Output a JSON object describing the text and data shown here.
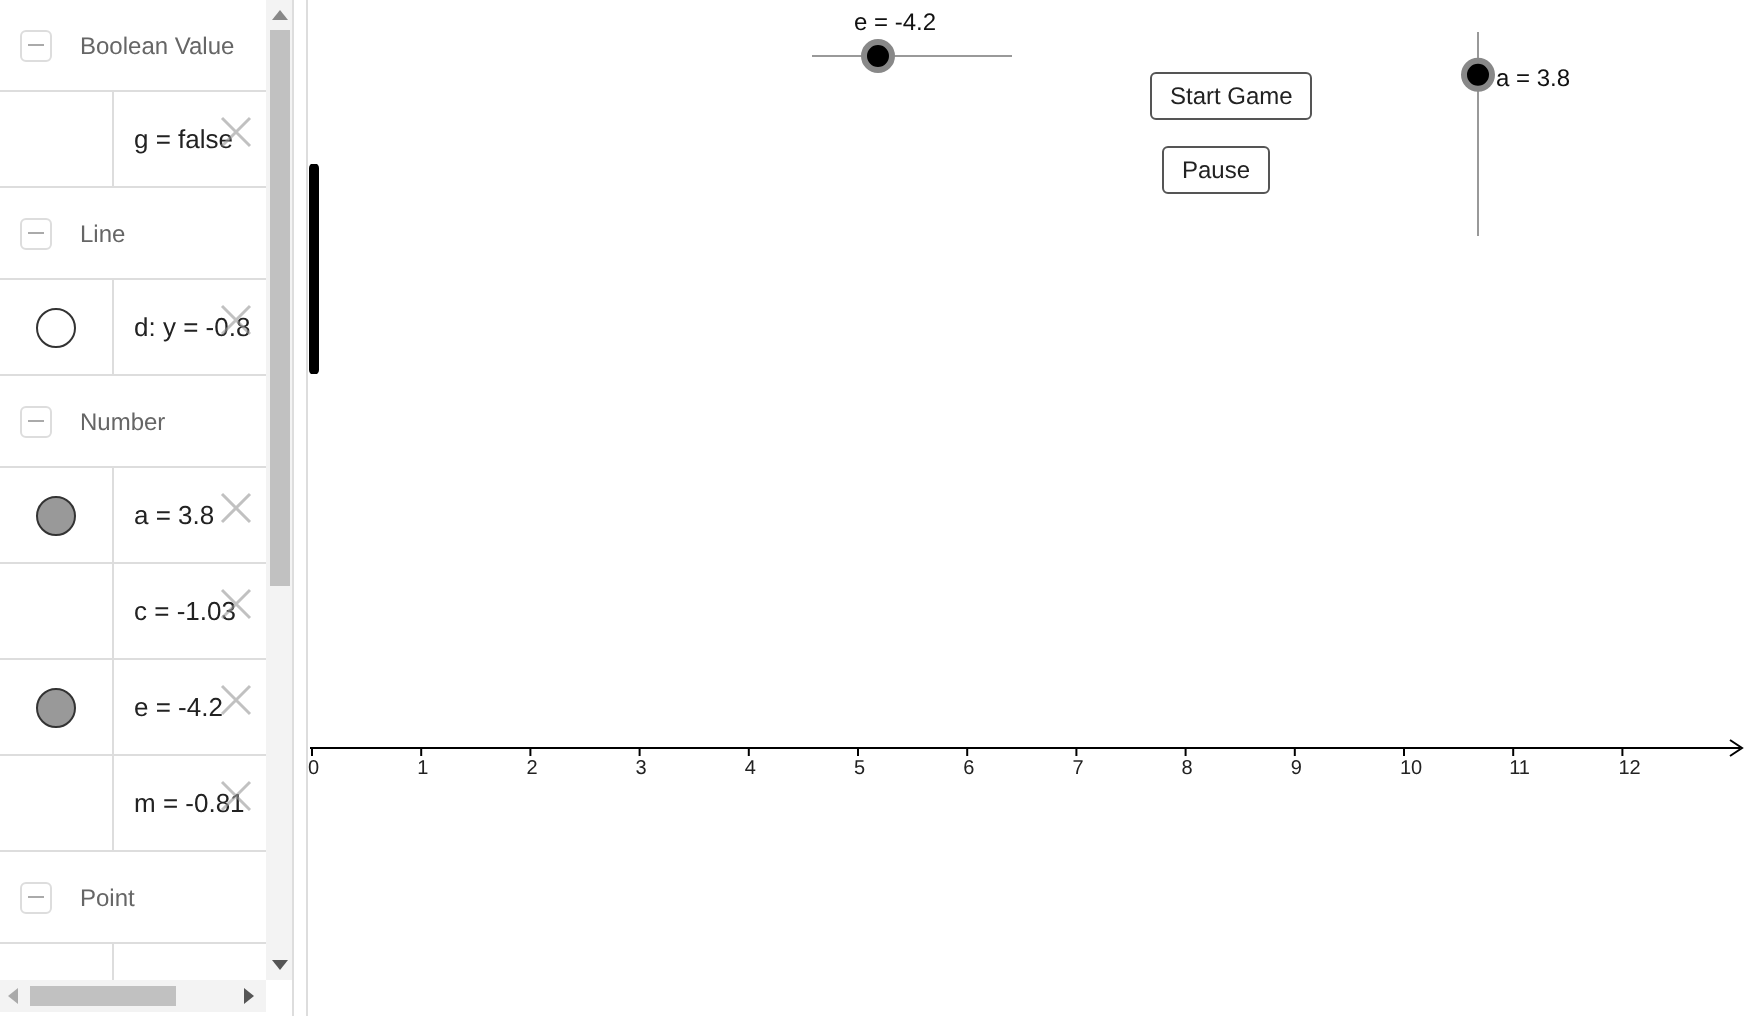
{
  "algebra": {
    "groups": [
      {
        "heading": "Boolean Value",
        "expanded": true,
        "items": [
          {
            "kind": "plain",
            "text": "g = false"
          }
        ]
      },
      {
        "heading": "Line",
        "expanded": true,
        "items": [
          {
            "kind": "marble",
            "visible": false,
            "text": "d: y = -0.8"
          }
        ]
      },
      {
        "heading": "Number",
        "expanded": true,
        "items": [
          {
            "kind": "marble",
            "visible": true,
            "text": "a = 3.8"
          },
          {
            "kind": "plain",
            "text": "c = -1.03"
          },
          {
            "kind": "marble",
            "visible": true,
            "text": "e = -4.2"
          },
          {
            "kind": "plain",
            "text": "m = -0.81"
          }
        ]
      },
      {
        "heading": "Point",
        "expanded": true
      }
    ]
  },
  "graphics": {
    "sliders": [
      {
        "kind": "horizontal",
        "label": "e = -4.2",
        "level": 0.33
      },
      {
        "kind": "vertical",
        "label": "a = 3.8",
        "level": 0.79
      }
    ],
    "buttons": [
      "Start Game",
      "Pause"
    ],
    "x_axis": {
      "ticks": [
        "0",
        "1",
        "2",
        "3",
        "4",
        "5",
        "6",
        "7",
        "8",
        "9",
        "10",
        "11",
        "12"
      ]
    }
  }
}
